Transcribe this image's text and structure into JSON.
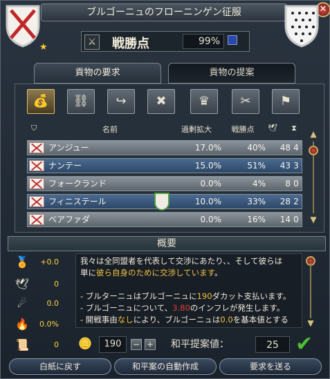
{
  "window": {
    "title": "ブルゴーニュのフローニンゲン征服",
    "close_glyph": "✕"
  },
  "warscore": {
    "icon_glyph": "⚔",
    "label": "戦勝点",
    "value": "99%"
  },
  "tabs": [
    {
      "label": "貢物の要求",
      "active": true
    },
    {
      "label": "貢物の提案",
      "active": false
    }
  ],
  "demand_icons": [
    {
      "name": "coin-bag-icon",
      "glyph": "💰",
      "active": true
    },
    {
      "name": "release-annexed-icon",
      "glyph": "⛓"
    },
    {
      "name": "transfer-province-icon",
      "glyph": "↪"
    },
    {
      "name": "break-alliance-icon",
      "glyph": "✖"
    },
    {
      "name": "crown-icon",
      "glyph": "♛"
    },
    {
      "name": "cancel-claims-icon",
      "glyph": "✂"
    },
    {
      "name": "humiliate-icon",
      "glyph": "⚑"
    }
  ],
  "table": {
    "headers": {
      "name": "名前",
      "overextension": "過剰拡大",
      "warscore": "戦勝点"
    },
    "rows": [
      {
        "name": "アンジュー",
        "over": "17.0%",
        "ws": "40%",
        "dev": "48",
        "forts": "4"
      },
      {
        "name": "ナンテー",
        "over": "15.0%",
        "ws": "51%",
        "dev": "43",
        "forts": "3"
      },
      {
        "name": "フォークランド",
        "over": "0.0%",
        "ws": "4%",
        "dev": "8",
        "forts": "0"
      },
      {
        "name": "フィニステール",
        "over": "10.0%",
        "ws": "33%",
        "dev": "28",
        "forts": "2"
      },
      {
        "name": "ベアファダ",
        "over": "0.0%",
        "ws": "16%",
        "dev": "14",
        "forts": "0"
      }
    ]
  },
  "summary": {
    "title": "概要",
    "side": [
      {
        "name": "prestige-icon",
        "glyph": "🏅",
        "value": "+0.0"
      },
      {
        "name": "peace-dove-icon",
        "glyph": "🕊",
        "value": "0"
      },
      {
        "name": "war-exhaustion-icon",
        "glyph": "☄",
        "value": "0.0"
      },
      {
        "name": "aggressive-expansion-icon",
        "glyph": "🔥",
        "value": "0.0%"
      },
      {
        "name": "truce-icon",
        "glyph": "📜",
        "value": "0"
      }
    ],
    "text": {
      "l1": "我々は全同盟者を代表して交渉にあたり、、そして彼らは",
      "l2a": "単に",
      "l2b": "彼ら自身のために交渉しています",
      "l2c": "。",
      "l3a": "- ブルターニュはブルゴーニュに",
      "l3b": "190",
      "l3c": "ダカット支払います。",
      "l4a": "- ブルゴーニュについて、",
      "l4b": "3.80",
      "l4c": "のインフレが発生します。",
      "l5a": "- 開戦事由",
      "l5b": "なし",
      "l5c": "により、ブルゴーニュは",
      "l5d": "0.0",
      "l5e": "を基本値とする"
    }
  },
  "gold": {
    "value": "190",
    "minus": "−",
    "plus": "+"
  },
  "peace": {
    "label": "和平提案値：",
    "value": "25",
    "accept_glyph": "✔"
  },
  "buttons": {
    "reset": "白紙に戻す",
    "auto": "和平案の自動作成",
    "send": "要求を送る"
  }
}
